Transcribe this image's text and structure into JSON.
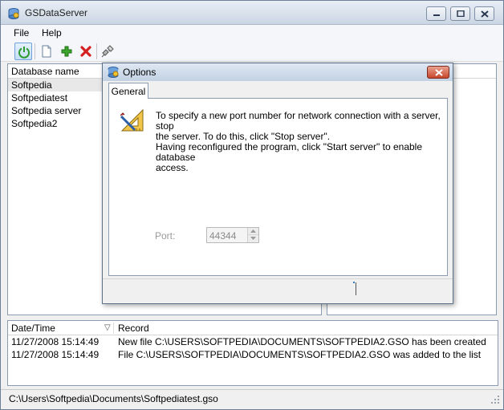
{
  "window": {
    "title": "GSDataServer"
  },
  "menu": {
    "items": [
      "File",
      "Help"
    ]
  },
  "toolbar": {
    "buttons": [
      "power-icon",
      "new-document-icon",
      "add-icon",
      "delete-icon",
      "disconnect-icon"
    ]
  },
  "databases": {
    "header": "Database name",
    "items": [
      "Softpedia",
      "Softpediatest",
      "Softpedia server",
      "Softpedia2"
    ],
    "selected_index": 0
  },
  "log": {
    "header_date": "Date/Time",
    "header_record": "Record",
    "sort_indicator": "▽",
    "rows": [
      {
        "date": "11/27/2008 15:14:49",
        "record": "New file C:\\USERS\\SOFTPEDIA\\DOCUMENTS\\SOFTPEDIA2.GSO has been created"
      },
      {
        "date": "11/27/2008 15:14:49",
        "record": "File C:\\USERS\\SOFTPEDIA\\DOCUMENTS\\SOFTPEDIA2.GSO was added to the list"
      }
    ]
  },
  "status": {
    "path": "C:\\Users\\Softpedia\\Documents\\Softpediatest.gso"
  },
  "dialog": {
    "title": "Options",
    "tab": "General",
    "message_lines": [
      "To specify a new port number for network connection with a server, stop",
      "the server. To do this, click \"Stop server\".",
      "Having reconfigured the program, click \"Start server\" to enable database",
      "access."
    ],
    "port_label": "Port:",
    "port_value": "44344"
  },
  "colors": {
    "title_gradient_top": "#e9eef5",
    "close_button": "#c9462b",
    "power_icon": "#2e9a2e",
    "add_icon": "#3aa52c",
    "delete_icon": "#d42020"
  }
}
